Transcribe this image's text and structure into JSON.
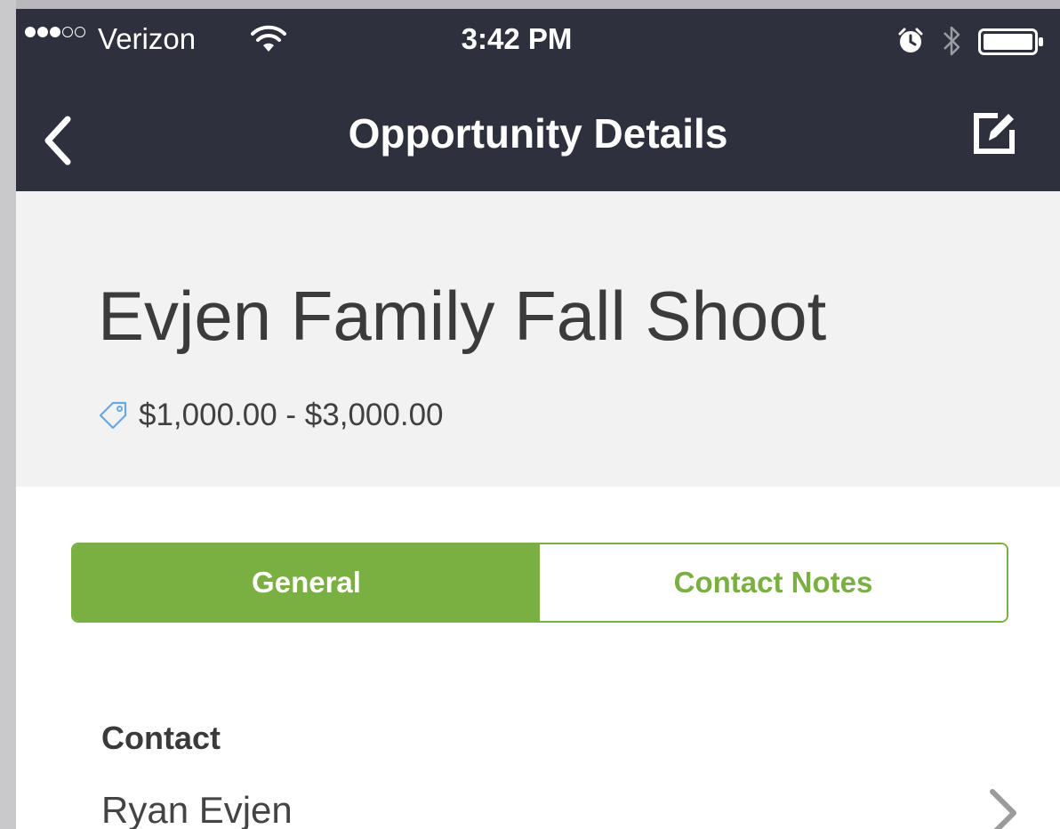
{
  "status_bar": {
    "signal_bars_filled": 3,
    "signal_bars_total": 5,
    "carrier": "Verizon",
    "time": "3:42 PM",
    "icons": [
      "wifi-icon",
      "alarm-icon",
      "bluetooth-icon",
      "battery-icon"
    ]
  },
  "navbar": {
    "title": "Opportunity Details",
    "back_icon": "chevron-left-icon",
    "edit_icon": "edit-icon"
  },
  "opportunity": {
    "name": "Evjen Family Fall Shoot",
    "price_icon": "tag-icon",
    "price_range": "$1,000.00 - $3,000.00"
  },
  "tabs": [
    {
      "label": "General",
      "active": true
    },
    {
      "label": "Contact Notes",
      "active": false
    }
  ],
  "contact": {
    "label": "Contact",
    "name": "Ryan Evjen",
    "disclosure_icon": "chevron-right-icon"
  },
  "colors": {
    "navbar_bg": "#2e313d",
    "header_bg": "#f2f2f2",
    "accent_green": "#7ab041",
    "tag_blue": "#6aa8e0"
  }
}
